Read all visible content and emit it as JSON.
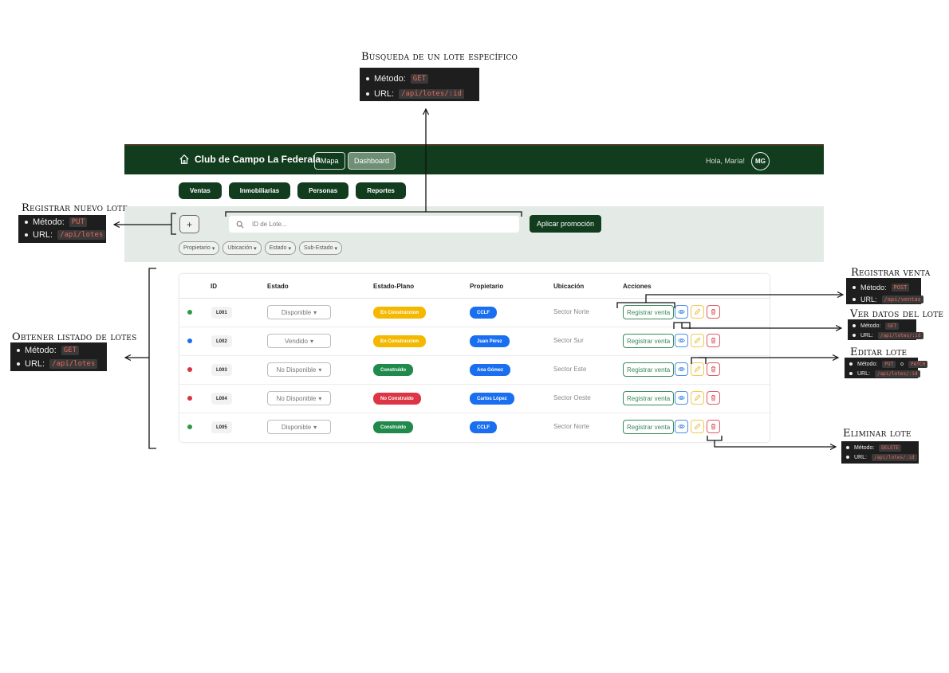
{
  "annotations": {
    "search_one": {
      "title": "Búsqueda de un lote específico",
      "method_label": "Método:",
      "method": "GET",
      "url_label": "URL:",
      "url": "/api/lotes/:id"
    },
    "register_new": {
      "title": "Registrar nuevo lote",
      "method_label": "Método:",
      "method": "PUT",
      "url_label": "URL:",
      "url": "/api/lotes"
    },
    "list_lotes": {
      "title": "Obtener listado de lotes",
      "method_label": "Método:",
      "method": "GET",
      "url_label": "URL:",
      "url": "/api/lotes"
    },
    "register_sale": {
      "title": "Registrar venta",
      "method_label": "Método:",
      "method": "POST",
      "url_label": "URL:",
      "url": "/api/ventas"
    },
    "view_lote": {
      "title": "Ver datos del lote",
      "method_label": "Método:",
      "method": "GET",
      "url_label": "URL:",
      "url": "/api/lotes/:id"
    },
    "edit_lote": {
      "title": "Editar lote",
      "method_label": "Método:",
      "method": "PUT",
      "or": "o",
      "method2": "PATCH",
      "url_label": "URL:",
      "url": "/api/lotes/:id"
    },
    "delete_lote": {
      "title": "Eliminar lote",
      "method_label": "Método:",
      "method": "DELETE",
      "url_label": "URL:",
      "url": "/api/lotes/:id"
    }
  },
  "app": {
    "brand": "Club de Campo La Federala",
    "nav": {
      "mapa": "Mapa",
      "dashboard": "Dashboard"
    },
    "greeting": "Hola, María!",
    "avatar": "MG",
    "tabs": [
      "Ventas",
      "Inmobiliarias",
      "Personas",
      "Reportes"
    ],
    "add_label": "+",
    "search_placeholder": "ID de Lote...",
    "promo_button": "Aplicar promoción",
    "filters": [
      "Propietario",
      "Ubicación",
      "Estado",
      "Sub-Estado"
    ],
    "table": {
      "headers": {
        "id": "ID",
        "estado": "Estado",
        "plano": "Estado-Plano",
        "propietario": "Propietario",
        "ubicacion": "Ubicación",
        "acciones": "Acciones"
      },
      "register_label": "Registrar venta",
      "rows": [
        {
          "dot_color": "#2e9a48",
          "id": "L001",
          "estado": "Disponible",
          "plano": "En Construccion",
          "plano_color": "#f5b800",
          "owner": "CCLF",
          "ubicacion": "Sector Norte"
        },
        {
          "dot_color": "#1a6ff0",
          "id": "L002",
          "estado": "Vendido",
          "plano": "En Construccion",
          "plano_color": "#f5b800",
          "owner": "Juan Pérez",
          "ubicacion": "Sector Sur"
        },
        {
          "dot_color": "#d9343f",
          "id": "L003",
          "estado": "No Disponible",
          "plano": "Construido",
          "plano_color": "#1f8a4c",
          "owner": "Ana Gómez",
          "ubicacion": "Sector Este"
        },
        {
          "dot_color": "#d9343f",
          "id": "L004",
          "estado": "No Disponible",
          "plano": "No Construido",
          "plano_color": "#dc3545",
          "owner": "Carlos López",
          "ubicacion": "Sector Oeste"
        },
        {
          "dot_color": "#2e9a48",
          "id": "L005",
          "estado": "Disponible",
          "plano": "Construido",
          "plano_color": "#1f8a4c",
          "owner": "CCLF",
          "ubicacion": "Sector Norte"
        }
      ]
    }
  }
}
